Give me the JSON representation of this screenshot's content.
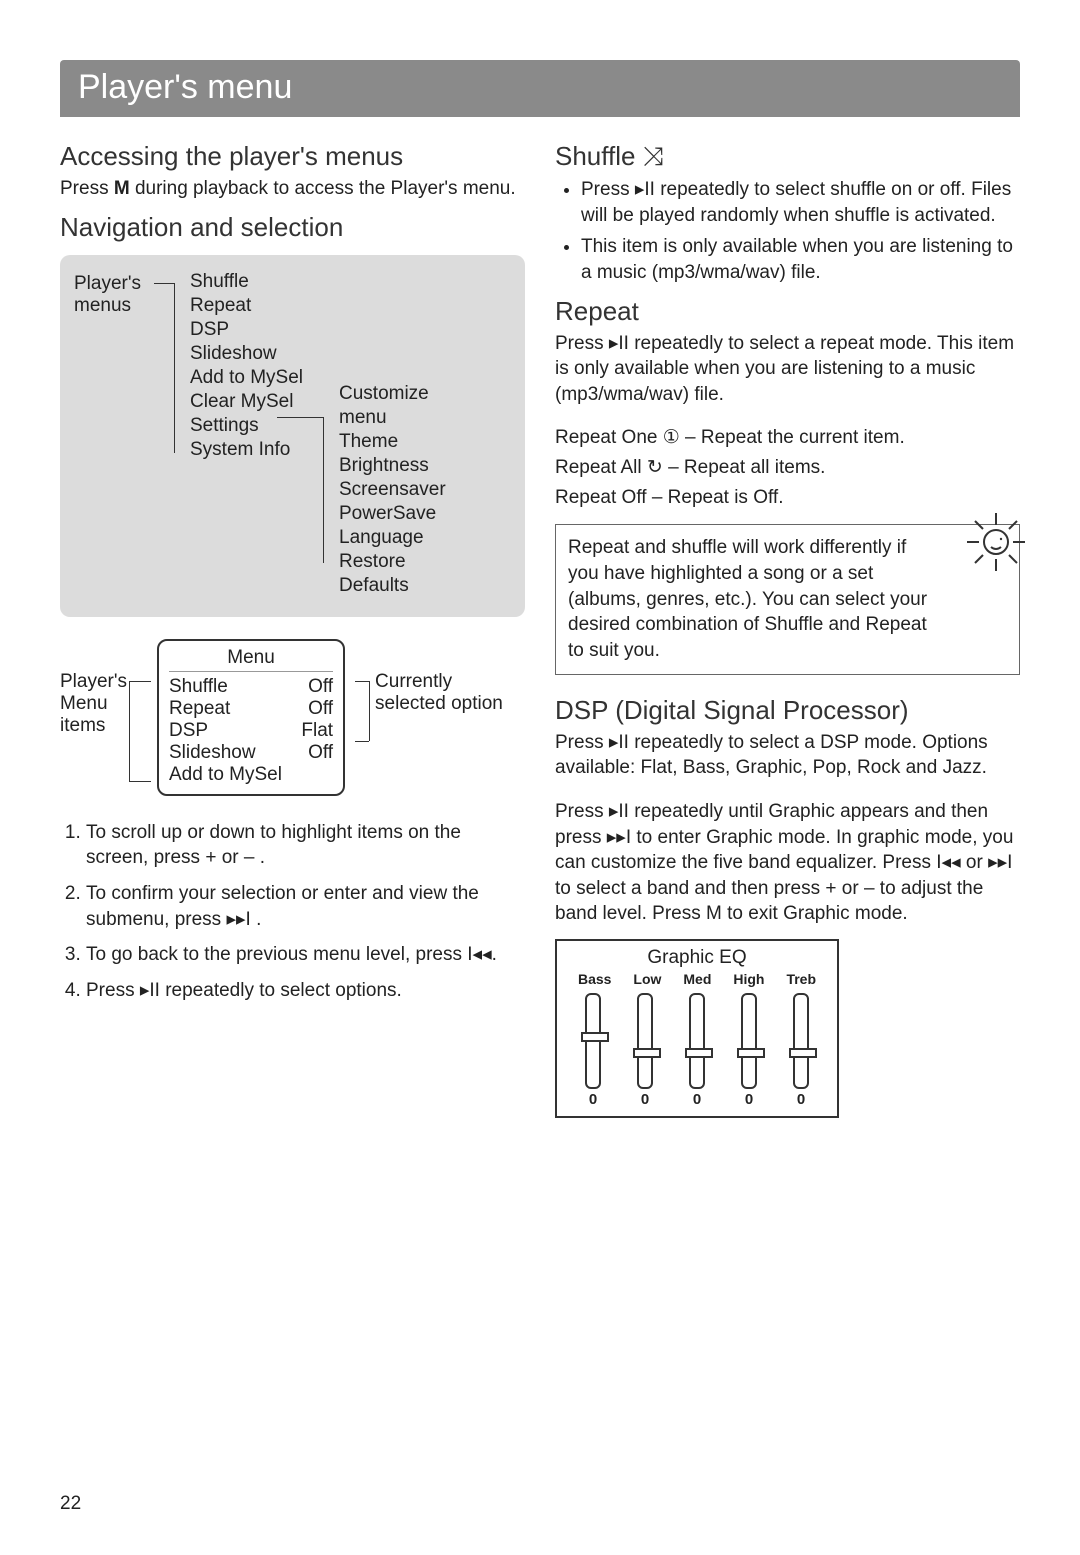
{
  "page_number": "22",
  "header": "Player's menu",
  "symbols": {
    "play_pause": "▸II",
    "next": "▸▸I",
    "prev": "I◂◂",
    "shuffle": "⤨",
    "repeat_one": "①",
    "repeat_all": "↻",
    "plus": "+",
    "minus": "–"
  },
  "left": {
    "accessing": {
      "heading": "Accessing the player's menus",
      "text_pre": "Press ",
      "text_bold": "M",
      "text_post": " during playback to access the Player's menu."
    },
    "nav_heading": "Navigation and selection",
    "tree": {
      "root_label": "Player's menus",
      "items": [
        "Shuffle",
        "Repeat",
        "DSP",
        "Slideshow",
        "Add to MySel",
        "Clear MySel",
        "Settings",
        "System Info"
      ],
      "settings_label_note": "Customize menu",
      "settings_sub": [
        "Theme",
        "Brightness",
        "Screensaver",
        "PowerSave",
        "Language",
        "Restore Defaults"
      ]
    },
    "lcd": {
      "left_label": "Player's Menu items",
      "right_label": "Currently selected option",
      "title": "Menu",
      "rows": [
        {
          "name": "Shuffle",
          "value": "Off"
        },
        {
          "name": "Repeat",
          "value": "Off"
        },
        {
          "name": "DSP",
          "value": "Flat"
        },
        {
          "name": "Slideshow",
          "value": "Off"
        },
        {
          "name": "Add to MySel",
          "value": ""
        }
      ]
    },
    "steps": [
      "To scroll up or down to highlight items on the screen, press  +  or  –  .",
      "To confirm your selection or enter and view the submenu, press  ▸▸I .",
      "To go back to the previous menu level, press  I◂◂.",
      "Press ▸II  repeatedly to select options."
    ]
  },
  "right": {
    "shuffle": {
      "heading": "Shuffle",
      "bullets": [
        "Press ▸II repeatedly to select shuffle on or off. Files will be played randomly when shuffle is activated.",
        "This item is only available when you are listening to a music (mp3/wma/wav) file."
      ]
    },
    "repeat": {
      "heading": "Repeat",
      "intro": "Press ▸II repeatedly to select a repeat mode. This item is only available when you are listening to a music (mp3/wma/wav) file.",
      "modes": [
        "Repeat One ① – Repeat the current item.",
        "Repeat All ↻ – Repeat all items.",
        "Repeat Off – Repeat is Off."
      ],
      "tip": "Repeat and shuffle will work differently if you have highlighted a song or a set (albums, genres, etc.). You can select your desired combination of Shuffle and Repeat to suit you."
    },
    "dsp": {
      "heading": "DSP (Digital Signal Processor)",
      "p1": "Press ▸II repeatedly to select a DSP mode. Options available: Flat, Bass, Graphic, Pop, Rock and Jazz.",
      "p2": "Press ▸II repeatedly until Graphic appears and then press ▸▸I to enter Graphic mode. In graphic mode, you can customize the five band equalizer. Press I◂◂ or ▸▸I to select a band and then press  +  or  –  to adjust the band level. Press M to exit Graphic mode."
    },
    "eq": {
      "title": "Graphic EQ",
      "bands": [
        "Bass",
        "Low",
        "Med",
        "High",
        "Treb"
      ],
      "values": [
        "0",
        "0",
        "0",
        "0",
        "0"
      ],
      "thumb_pos_pct": [
        40,
        58,
        58,
        58,
        58
      ]
    }
  }
}
